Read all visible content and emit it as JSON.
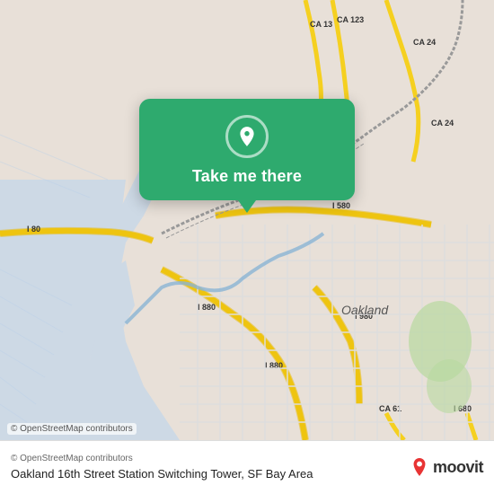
{
  "map": {
    "attribution": "© OpenStreetMap contributors",
    "background_color": "#e8e0d8"
  },
  "popup": {
    "button_label": "Take me there",
    "background_color": "#2eaa6e"
  },
  "footer": {
    "station_name": "Oakland 16th Street Station Switching Tower, SF Bay Area",
    "attribution": "© OpenStreetMap contributors",
    "moovit_text": "moovit"
  },
  "icons": {
    "location_pin": "location-pin-icon",
    "moovit_logo": "moovit-logo-icon"
  }
}
